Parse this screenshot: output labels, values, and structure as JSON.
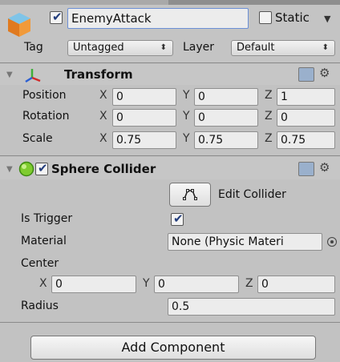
{
  "gameobject": {
    "name": "EnemyAttack",
    "active": true,
    "static_label": "Static",
    "tag_label": "Tag",
    "tag_value": "Untagged",
    "layer_label": "Layer",
    "layer_value": "Default"
  },
  "transform": {
    "title": "Transform",
    "position_label": "Position",
    "rotation_label": "Rotation",
    "scale_label": "Scale",
    "axis_x": "X",
    "axis_y": "Y",
    "axis_z": "Z",
    "position": {
      "x": "0",
      "y": "0",
      "z": "1"
    },
    "rotation": {
      "x": "0",
      "y": "0",
      "z": "0"
    },
    "scale": {
      "x": "0.75",
      "y": "0.75",
      "z": "0.75"
    }
  },
  "sphere_collider": {
    "title": "Sphere Collider",
    "enabled": true,
    "edit_collider_label": "Edit Collider",
    "is_trigger_label": "Is Trigger",
    "is_trigger": true,
    "material_label": "Material",
    "material_value": "None (Physic Materi",
    "center_label": "Center",
    "center": {
      "x": "0",
      "y": "0",
      "z": "0"
    },
    "radius_label": "Radius",
    "radius": "0.5"
  },
  "add_component_label": "Add Component",
  "colors": {
    "field_bg": "#ececec",
    "panel_bg": "#c2c2c2",
    "name_field_border": "#6b8fd6"
  }
}
